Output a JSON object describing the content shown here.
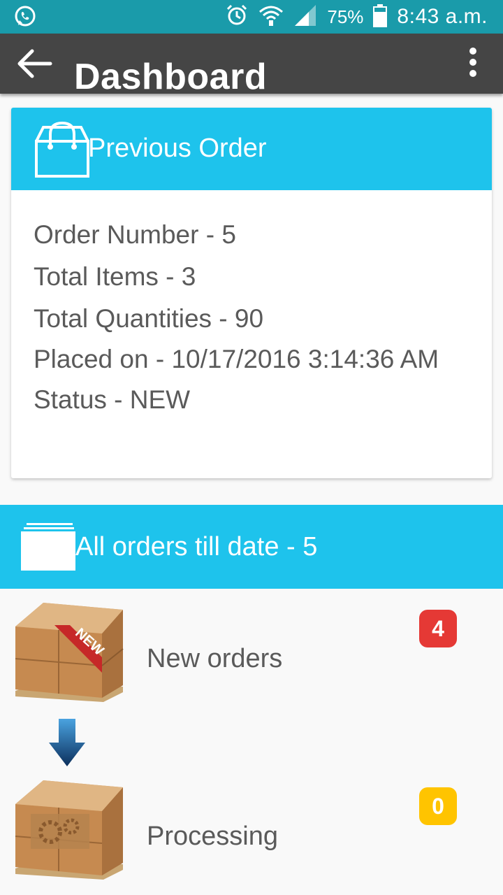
{
  "status_bar": {
    "battery_percent": "75%",
    "time": "8:43 a.m.",
    "icons": [
      "whatsapp-icon",
      "alarm-icon",
      "wifi-icon",
      "signal-icon",
      "battery-icon"
    ]
  },
  "app_bar": {
    "title": "Dashboard",
    "back_icon": "back-arrow-icon",
    "menu_icon": "more-vert-icon"
  },
  "previous_order": {
    "header": "Previous Order",
    "lines": [
      "Order Number - 5",
      "Total Items - 3",
      "Total Quantities - 90",
      "Placed on - 10/17/2016 3:14:36 AM",
      "Status - NEW"
    ]
  },
  "all_orders": {
    "header": "All orders till date - 5"
  },
  "order_rows": [
    {
      "label": "New orders",
      "count": "4",
      "badge_color": "#e53935",
      "image_badge": "NEW"
    },
    {
      "label": "Processing",
      "count": "0",
      "badge_color": "#ffc400"
    }
  ],
  "colors": {
    "status_bar": "#1a9baa",
    "app_bar": "#454545",
    "accent": "#1ec3ec"
  }
}
